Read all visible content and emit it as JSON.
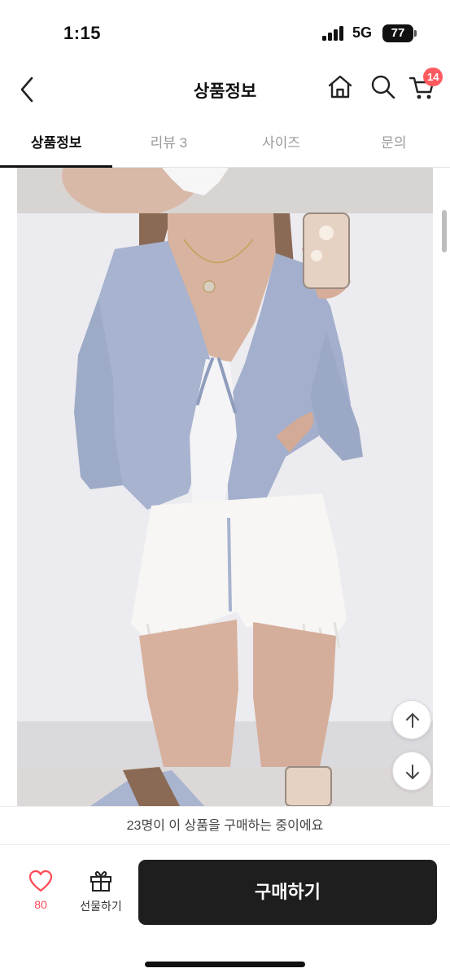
{
  "status_bar": {
    "time": "1:15",
    "network": "5G",
    "battery": "77"
  },
  "header": {
    "title": "상품정보",
    "cart_badge": "14",
    "icons": [
      "chevron-left-icon",
      "home-icon",
      "search-icon",
      "cart-icon"
    ]
  },
  "tabs": [
    {
      "label": "상품정보",
      "active": true
    },
    {
      "label": "리뷰 3",
      "active": false
    },
    {
      "label": "사이즈",
      "active": false
    },
    {
      "label": "문의",
      "active": false
    }
  ],
  "colors": {
    "accent": "#ff5a5f",
    "buy_button": "#1e1e1e",
    "like": "#ff4a55"
  },
  "notice": {
    "text": "23명이 이 상품을 구매하는 중이에요"
  },
  "actions": {
    "like_count": "80",
    "gift_label": "선물하기",
    "buy_label": "구매하기"
  }
}
